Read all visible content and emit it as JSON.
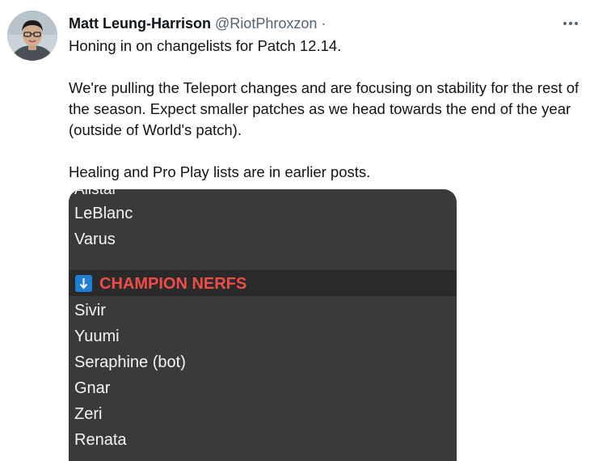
{
  "author": {
    "name": "Matt Leung-Harrison",
    "handle": "@RiotPhroxzon",
    "separator": "·"
  },
  "icons": {
    "more": "more-horizontal-icon",
    "section": "down-arrow-icon"
  },
  "tweet": {
    "line1": "Honing in on changelists for Patch 12.14.",
    "line2": "We're pulling the Teleport changes and are focusing on stability for the rest of the season. Expect smaller patches as we head towards the end of the year (outside of World's patch).",
    "line3": "Healing and Pro Play lists are in earlier posts."
  },
  "image": {
    "cut_item": "Alistar",
    "top_items": [
      "LeBlanc",
      "Varus"
    ],
    "section_title": "CHAMPION NERFS",
    "nerf_items": [
      "Sivir",
      "Yuumi",
      "Seraphine (bot)",
      "Gnar",
      "Zeri",
      "Renata"
    ]
  },
  "colors": {
    "accent_red": "#ee4d48",
    "arrow_blue": "#1f7fd6",
    "image_bg": "#3a3a3a",
    "header_bg": "#2a2a2a"
  }
}
